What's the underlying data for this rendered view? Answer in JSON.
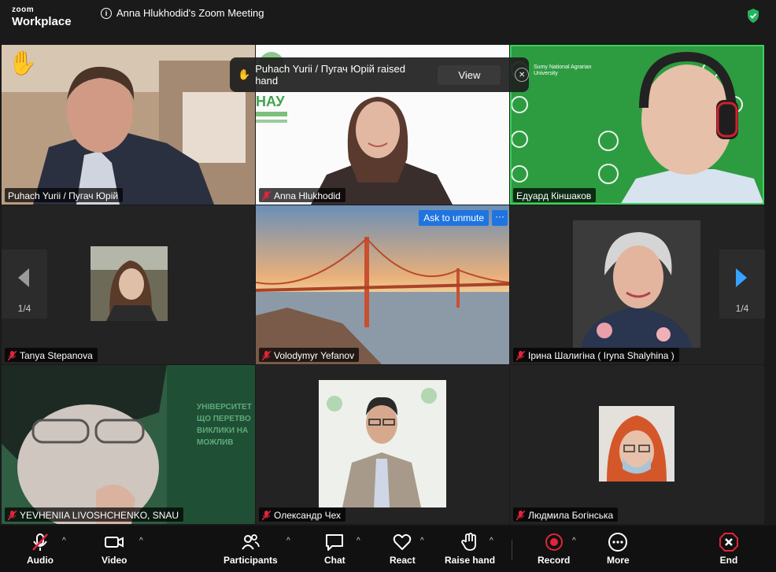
{
  "app": {
    "logo_line1": "zoom",
    "logo_line2": "Workplace",
    "meeting_title": "Anna Hlukhodid's Zoom Meeting"
  },
  "toast": {
    "text": "Puhach Yurii / Пугач Юрій raised hand",
    "view_label": "View"
  },
  "tile_actions": {
    "ask_to_unmute": "Ask to unmute",
    "more": "···"
  },
  "pager": {
    "left_page": "1/4",
    "right_page": "1/4"
  },
  "participants": [
    {
      "name": "Puhach Yurii / Пугач Юрій",
      "muted": false,
      "hand_raised": true
    },
    {
      "name": "Anna Hlukhodid",
      "muted": true
    },
    {
      "name": "Едуард Кіншаков",
      "muted": false,
      "active_speaker": true
    },
    {
      "name": "Tanya Stepanova",
      "muted": true
    },
    {
      "name": "Volodymyr Yefanov",
      "muted": true
    },
    {
      "name": "Ірина Шалигіна ( Iryna Shalyhina )",
      "muted": true
    },
    {
      "name": "YEVHENIIA  LIVOSHCHENKO, SNAU",
      "muted": true
    },
    {
      "name": "Олександр Чех",
      "muted": true
    },
    {
      "name": "Людмила Богінська",
      "muted": true
    }
  ],
  "background_text": {
    "sumy": "Sumy National Agrarian University",
    "nau": "НАУ",
    "livo": "УНІВЕРСИТЕТ ЩО ПЕРЕТВО ВИКЛИКИ НА МОЖЛИВ"
  },
  "toolbar": {
    "audio": "Audio",
    "video": "Video",
    "participants": "Participants",
    "chat": "Chat",
    "react": "React",
    "raise_hand": "Raise hand",
    "record": "Record",
    "more": "More",
    "end": "End"
  },
  "colors": {
    "active_speaker": "#3ecf5c",
    "accent_blue": "#1f74e0",
    "end_red": "#e0243b",
    "muted_red": "#e0243b"
  }
}
